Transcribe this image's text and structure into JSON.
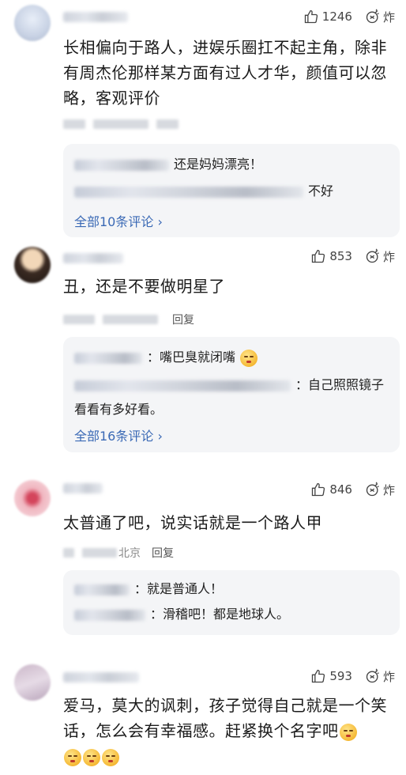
{
  "comments": [
    {
      "likes": "1246",
      "boom": "炸",
      "text": "长相偏向于路人，进娱乐圈扛不起主角，除非有周杰伦那样某方面有过人才华，颜值可以忽略，客观评价",
      "replies": [
        {
          "text": "还是妈妈漂亮！"
        },
        {
          "text": "不好"
        }
      ],
      "more_label": "全部10条评论 ›"
    },
    {
      "likes": "853",
      "boom": "炸",
      "text": "丑，还是不要做明星了",
      "reply_label": "回复",
      "replies": [
        {
          "text": "嘴巴臭就闭嘴"
        },
        {
          "text": "自己照照镜子看看有多好看。"
        }
      ],
      "more_label": "全部16条评论 ›"
    },
    {
      "likes": "846",
      "boom": "炸",
      "text": "太普通了吧，说实话就是一个路人甲",
      "meta_location": "北京",
      "reply_label": "回复",
      "replies": [
        {
          "text": "就是普通人！"
        },
        {
          "text": "滑稽吧！都是地球人。"
        }
      ]
    },
    {
      "likes": "593",
      "boom": "炸",
      "text": "爱马，莫大的讽刺，孩子觉得自己就是一个笑话，怎么会有幸福感。赶紧换个名字吧"
    }
  ],
  "icons": {
    "like": "thumbs-up-icon",
    "boom": "boom-icon",
    "emoji": "grimace-emoji-icon"
  }
}
